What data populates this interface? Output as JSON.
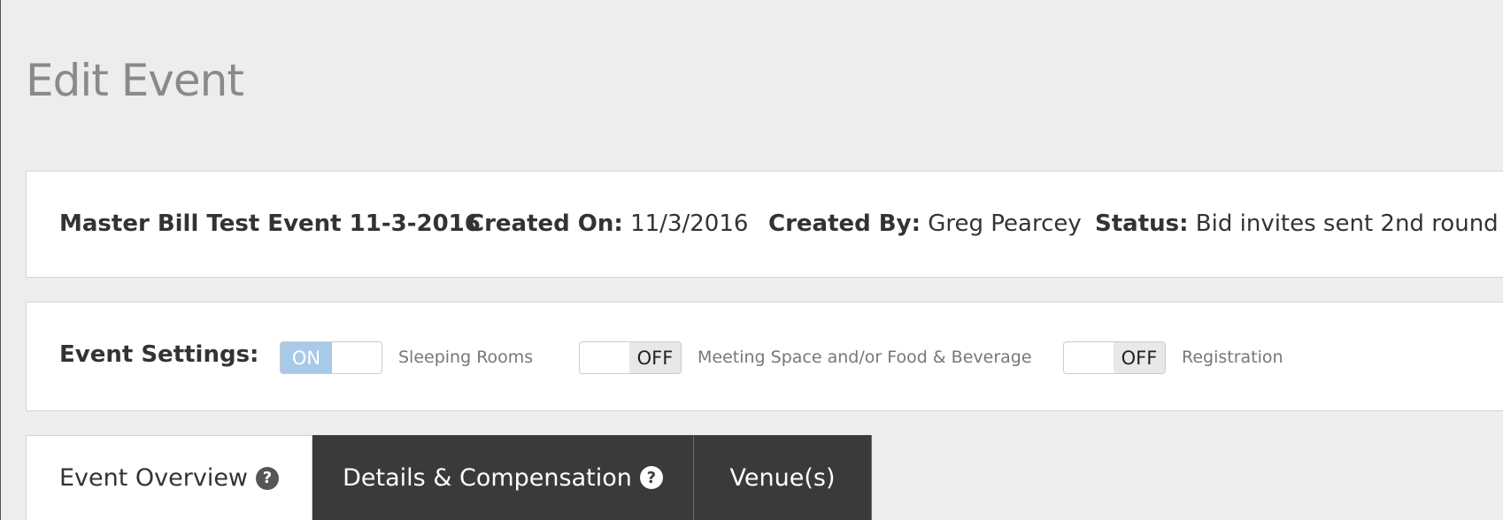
{
  "page": {
    "title": "Edit Event"
  },
  "event_info": {
    "name": "Master Bill Test Event 11-3-2016",
    "created_on_label": "Created On:",
    "created_on_value": "11/3/2016",
    "created_by_label": "Created By:",
    "created_by_value": "Greg Pearcey",
    "status_label": "Status:",
    "status_value": "Bid invites sent 2nd round"
  },
  "settings": {
    "label": "Event Settings:",
    "toggles": [
      {
        "state": "ON",
        "label": "Sleeping Rooms"
      },
      {
        "state": "OFF",
        "label": "Meeting Space and/or Food & Beverage"
      },
      {
        "state": "OFF",
        "label": "Registration"
      }
    ]
  },
  "tabs": [
    {
      "label": "Event Overview",
      "help_icon": "?"
    },
    {
      "label": "Details & Compensation",
      "help_icon": "?"
    },
    {
      "label": "Venue(s)"
    }
  ],
  "colors": {
    "toggle_on": "#a8c9e8",
    "tab_dark": "#3a3a3a",
    "background": "#ededed"
  }
}
